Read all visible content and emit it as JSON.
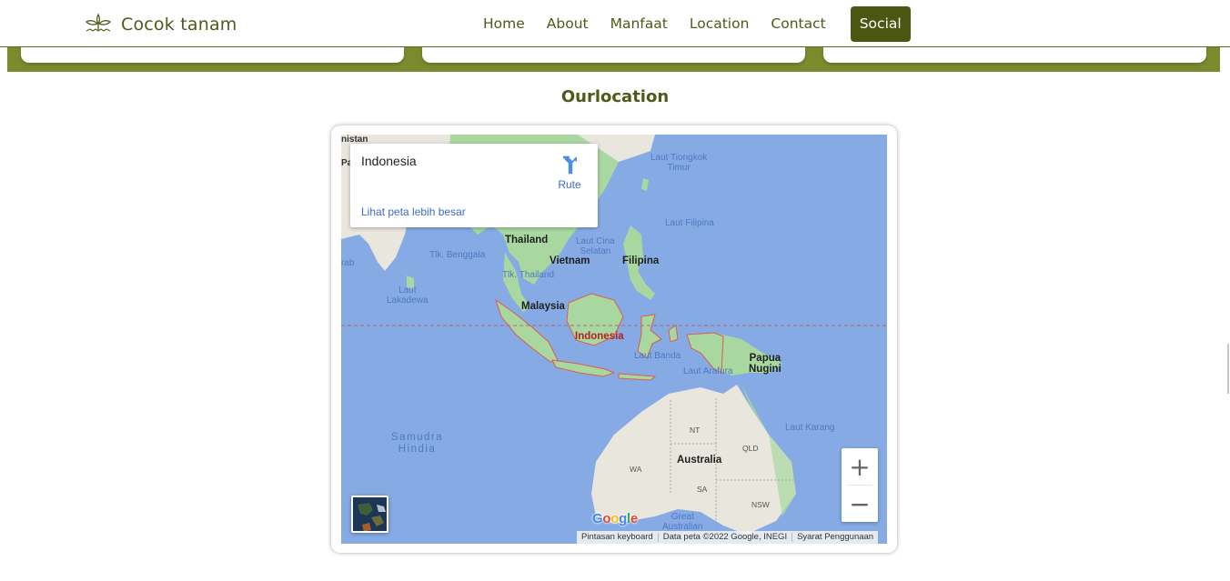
{
  "brand": {
    "name": "Cocok tanam",
    "icon": "plant-sprout-icon"
  },
  "nav": {
    "links": [
      "Home",
      "About",
      "Manfaat",
      "Location",
      "Contact"
    ],
    "cta_label": "Social"
  },
  "colors": {
    "brand": "#4e5a1a",
    "band": "#7c8a2e",
    "cta": "#4b5710",
    "water": "#86abe4",
    "land": "#a8d8a0",
    "border_highlight": "#d9534f"
  },
  "section": {
    "title": "Ourlocation"
  },
  "map": {
    "info_card": {
      "title": "Indonesia",
      "route_label": "Rute",
      "larger_map_link": "Lihat peta lebih besar"
    },
    "labels": {
      "nistan": "nistan",
      "pa": "Pa",
      "rab": "rab",
      "laut_tiongkok": "Laut Tiongkok\nTimur",
      "laut_filipina": "Laut Filipina",
      "thailand": "Thailand",
      "laut_cina": "Laut Cina\nSelatan",
      "tlk_benggala": "Tlk. Benggala",
      "vietnam": "Vietnam",
      "filipina": "Filipina",
      "tlk_thailand": "Tlk. Thailand",
      "laut_lakadewa": "Laut\nLakadewa",
      "malaysia": "Malaysia",
      "indonesia": "Indonesia",
      "laut_banda": "Laut Banda",
      "laut_arafura": "Laut Arafura",
      "papua": "Papua\nNugini",
      "laut_karang": "Laut Karang",
      "samudra": "Samudra\nHindia",
      "nt": "NT",
      "qld": "QLD",
      "australia": "Australia",
      "wa": "WA",
      "sa": "SA",
      "nsw": "NSW",
      "great_australian": "Great\nAustralian"
    },
    "zoom_in": "+",
    "zoom_out": "−",
    "google_logo": "Google",
    "attribution": {
      "keyboard": "Pintasan keyboard",
      "data": "Data peta ©2022 Google, INEGI",
      "terms": "Syarat Penggunaan"
    }
  }
}
